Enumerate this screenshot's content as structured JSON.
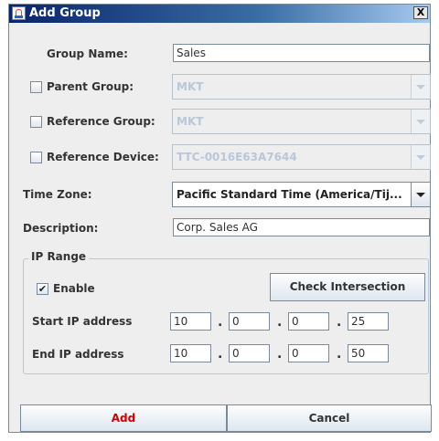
{
  "window": {
    "title": "Add Group",
    "close_symbol": "X"
  },
  "form": {
    "group_name_label": "Group Name:",
    "group_name_value": "Sales",
    "parent_group_label": "Parent Group:",
    "parent_group_value": "MKT",
    "parent_group_checked": false,
    "reference_group_label": "Reference Group:",
    "reference_group_value": "MKT",
    "reference_group_checked": false,
    "reference_device_label": "Reference Device:",
    "reference_device_value": "TTC-0016E63A7644",
    "reference_device_checked": false,
    "time_zone_label": "Time Zone:",
    "time_zone_value": "Pacific Standard Time (America/Tij...",
    "description_label": "Description:",
    "description_value": "Corp. Sales AG"
  },
  "ip_range": {
    "title": "IP Range",
    "enable_label": "Enable",
    "enable_checked": true,
    "check_intersection_label": "Check Intersection",
    "start_label": "Start IP address",
    "start_octets": [
      "10",
      "0",
      "0",
      "25"
    ],
    "end_label": "End IP address",
    "end_octets": [
      "10",
      "0",
      "0",
      "50"
    ],
    "separator": "."
  },
  "buttons": {
    "add_label": "Add",
    "cancel_label": "Cancel"
  },
  "colors": {
    "add_text": "#d40000",
    "disabled_text": "#b8c7d9",
    "title_bar": "#0a246a"
  }
}
